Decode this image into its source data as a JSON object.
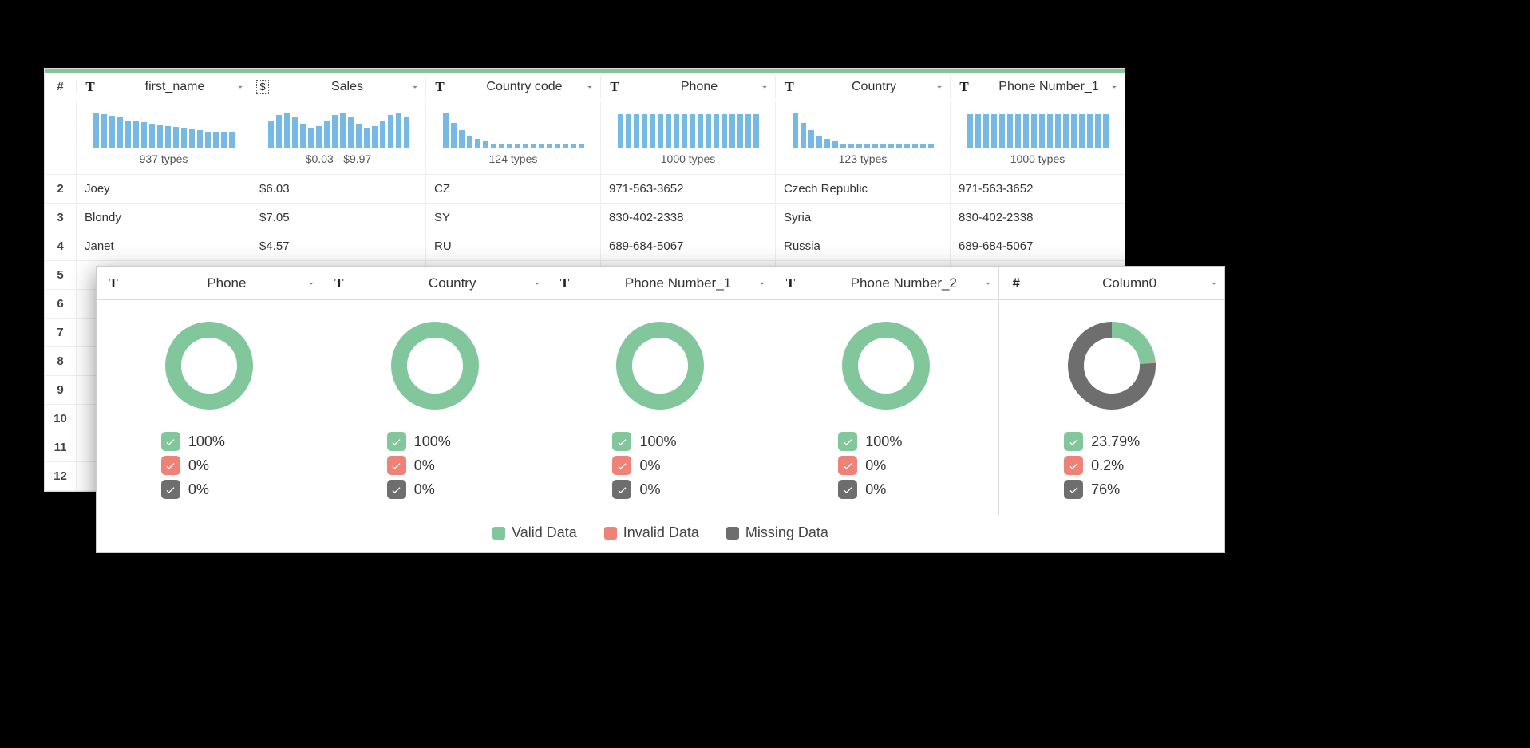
{
  "colors": {
    "green": "#82c79c",
    "red": "#ef8277",
    "gray": "#6e6e6e",
    "bar": "#76b9e4"
  },
  "back_table": {
    "row_header_symbol": "#",
    "columns": [
      {
        "type_icon": "T",
        "label": "first_name",
        "summary": "937 types",
        "bars_shape": "flat_tail"
      },
      {
        "type_icon": "$",
        "label": "Sales",
        "summary": "$0.03 - $9.97",
        "bars_shape": "flat_wavy"
      },
      {
        "type_icon": "T",
        "label": "Country code",
        "summary": "124 types",
        "bars_shape": "steep"
      },
      {
        "type_icon": "T",
        "label": "Phone",
        "summary": "1000 types",
        "bars_shape": "uniform"
      },
      {
        "type_icon": "T",
        "label": "Country",
        "summary": "123 types",
        "bars_shape": "steep"
      },
      {
        "type_icon": "T",
        "label": "Phone Number_1",
        "summary": "1000 types",
        "bars_shape": "uniform"
      }
    ],
    "rows": [
      {
        "n": "2",
        "cells": [
          "Joey",
          "$6.03",
          "CZ",
          "971-563-3652",
          "Czech Republic",
          "971-563-3652"
        ]
      },
      {
        "n": "3",
        "cells": [
          "Blondy",
          "$7.05",
          "SY",
          "830-402-2338",
          "Syria",
          "830-402-2338"
        ]
      },
      {
        "n": "4",
        "cells": [
          "Janet",
          "$4.57",
          "RU",
          "689-684-5067",
          "Russia",
          "689-684-5067"
        ]
      },
      {
        "n": "5",
        "cells": [
          "",
          "",
          "",
          "",
          "",
          ""
        ]
      },
      {
        "n": "6",
        "cells": [
          "",
          "",
          "",
          "",
          "",
          ""
        ]
      },
      {
        "n": "7",
        "cells": [
          "",
          "",
          "",
          "",
          "",
          ""
        ]
      },
      {
        "n": "8",
        "cells": [
          "",
          "",
          "",
          "",
          "",
          ""
        ]
      },
      {
        "n": "9",
        "cells": [
          "",
          "",
          "",
          "",
          "",
          ""
        ]
      },
      {
        "n": "10",
        "cells": [
          "",
          "",
          "",
          "",
          "",
          ""
        ]
      },
      {
        "n": "11",
        "cells": [
          "",
          "",
          "",
          "",
          "",
          ""
        ]
      },
      {
        "n": "12",
        "cells": [
          "",
          "",
          "",
          "",
          "",
          ""
        ]
      }
    ]
  },
  "front_panel": {
    "columns": [
      {
        "type_icon": "T",
        "label": "Phone",
        "valid": "100%",
        "invalid": "0%",
        "missing": "0%",
        "valid_pct_num": 100,
        "missing_pct_num": 0
      },
      {
        "type_icon": "T",
        "label": "Country",
        "valid": "100%",
        "invalid": "0%",
        "missing": "0%",
        "valid_pct_num": 100,
        "missing_pct_num": 0
      },
      {
        "type_icon": "T",
        "label": "Phone Number_1",
        "valid": "100%",
        "invalid": "0%",
        "missing": "0%",
        "valid_pct_num": 100,
        "missing_pct_num": 0
      },
      {
        "type_icon": "T",
        "label": "Phone Number_2",
        "valid": "100%",
        "invalid": "0%",
        "missing": "0%",
        "valid_pct_num": 100,
        "missing_pct_num": 0
      },
      {
        "type_icon": "#",
        "label": "Column0",
        "valid": "23.79%",
        "invalid": "0.2%",
        "missing": "76%",
        "valid_pct_num": 23.79,
        "missing_pct_num": 76
      }
    ],
    "legend": {
      "valid": "Valid Data",
      "invalid": "Invalid Data",
      "missing": "Missing Data"
    }
  },
  "chart_data": [
    {
      "type": "bar",
      "title": "first_name distribution",
      "shape": "flat_tail",
      "note": "937 types"
    },
    {
      "type": "bar",
      "title": "Sales distribution",
      "shape": "flat_wavy",
      "note": "$0.03 - $9.97"
    },
    {
      "type": "bar",
      "title": "Country code distribution",
      "shape": "steep",
      "note": "124 types"
    },
    {
      "type": "bar",
      "title": "Phone distribution",
      "shape": "uniform",
      "note": "1000 types"
    },
    {
      "type": "bar",
      "title": "Country distribution",
      "shape": "steep",
      "note": "123 types"
    },
    {
      "type": "bar",
      "title": "Phone Number_1 distribution",
      "shape": "uniform",
      "note": "1000 types"
    },
    {
      "type": "pie",
      "title": "Phone quality",
      "series": [
        {
          "name": "Valid",
          "value": 100
        },
        {
          "name": "Invalid",
          "value": 0
        },
        {
          "name": "Missing",
          "value": 0
        }
      ]
    },
    {
      "type": "pie",
      "title": "Country quality",
      "series": [
        {
          "name": "Valid",
          "value": 100
        },
        {
          "name": "Invalid",
          "value": 0
        },
        {
          "name": "Missing",
          "value": 0
        }
      ]
    },
    {
      "type": "pie",
      "title": "Phone Number_1 quality",
      "series": [
        {
          "name": "Valid",
          "value": 100
        },
        {
          "name": "Invalid",
          "value": 0
        },
        {
          "name": "Missing",
          "value": 0
        }
      ]
    },
    {
      "type": "pie",
      "title": "Phone Number_2 quality",
      "series": [
        {
          "name": "Valid",
          "value": 100
        },
        {
          "name": "Invalid",
          "value": 0
        },
        {
          "name": "Missing",
          "value": 0
        }
      ]
    },
    {
      "type": "pie",
      "title": "Column0 quality",
      "series": [
        {
          "name": "Valid",
          "value": 23.79
        },
        {
          "name": "Invalid",
          "value": 0.2
        },
        {
          "name": "Missing",
          "value": 76
        }
      ]
    }
  ]
}
